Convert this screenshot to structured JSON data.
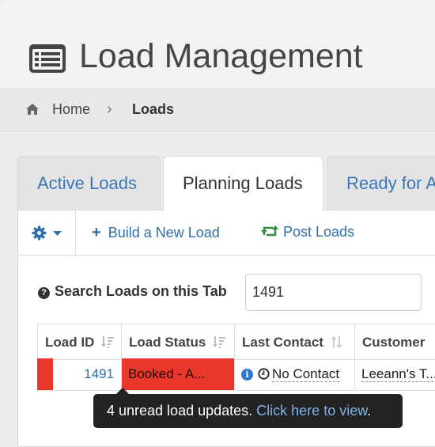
{
  "header": {
    "title": "Load Management",
    "icon": "list-alt-icon"
  },
  "breadcrumb": {
    "home": "Home",
    "current": "Loads"
  },
  "tabs": [
    {
      "label": "Active Loads",
      "active": false
    },
    {
      "label": "Planning Loads",
      "active": true
    },
    {
      "label": "Ready for A",
      "active": false
    }
  ],
  "toolbar": {
    "build_label": "Build a New Load",
    "post_label": "Post Loads"
  },
  "search": {
    "label": "Search Loads on this Tab",
    "value": "1491"
  },
  "table": {
    "columns": [
      "Load ID",
      "Load Status",
      "Last Contact",
      "Customer"
    ],
    "rows": [
      {
        "load_id": "1491",
        "status": "Booked - A...",
        "last_contact": "No Contact",
        "customer": "Leeann's T..."
      }
    ]
  },
  "toast": {
    "text": "4 unread load updates.",
    "link": "Click here to view",
    "suffix": "."
  },
  "colors": {
    "accent": "#2f6ea8",
    "status_red": "#e8382b",
    "toast_bg": "#222222"
  }
}
